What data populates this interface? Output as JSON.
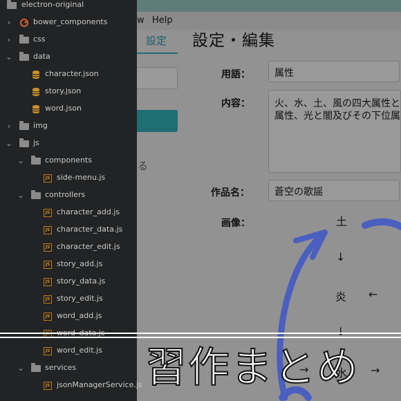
{
  "menu": {
    "view_fragment": "w",
    "help": "Help"
  },
  "tab": {
    "settings": "設定"
  },
  "left_pane": {
    "link_fragment": "る"
  },
  "page": {
    "title": "設定・編集"
  },
  "form": {
    "term_label": "用語：",
    "term_value": "属性",
    "content_label": "内容：",
    "content_line1": "火、水、土、風の四大属性と焔、",
    "content_line2": "属性、光と闇及びその下位属性",
    "work_label": "作品名：",
    "work_value": "蒼空の歌謡",
    "image_label": "画像："
  },
  "diagram": {
    "earth": "土",
    "arrow_down": "↓",
    "flame": "炎",
    "arrow_left": "←",
    "arrow_down2": "↓",
    "arrow_right_bottom": "→",
    "water": "水",
    "arrow_right": "→"
  },
  "file_tree": [
    {
      "label": "electron-original",
      "type": "root"
    },
    {
      "label": "bower_components",
      "type": "bower"
    },
    {
      "label": "css",
      "type": "folder"
    },
    {
      "label": "data",
      "type": "folder-open"
    },
    {
      "label": "character.json",
      "type": "db"
    },
    {
      "label": "story.json",
      "type": "db"
    },
    {
      "label": "word.json",
      "type": "db"
    },
    {
      "label": "img",
      "type": "folder"
    },
    {
      "label": "js",
      "type": "folder-open"
    },
    {
      "label": "components",
      "type": "folder-open"
    },
    {
      "label": "side-menu.js",
      "type": "js"
    },
    {
      "label": "controllers",
      "type": "folder-open"
    },
    {
      "label": "character_add.js",
      "type": "js"
    },
    {
      "label": "character_data.js",
      "type": "js"
    },
    {
      "label": "character_edit.js",
      "type": "js"
    },
    {
      "label": "story_add.js",
      "type": "js"
    },
    {
      "label": "story_data.js",
      "type": "js"
    },
    {
      "label": "story_edit.js",
      "type": "js"
    },
    {
      "label": "word_add.js",
      "type": "js"
    },
    {
      "label": "word_data.js",
      "type": "js"
    },
    {
      "label": "word_edit.js",
      "type": "js"
    },
    {
      "label": "services",
      "type": "folder-open"
    },
    {
      "label": "jsonManagerService.js",
      "type": "js"
    }
  ],
  "caption": {
    "text": "習作まとめ"
  },
  "colors": {
    "sidebar_bg": "#222324",
    "accent_teal": "#1f6e75",
    "arrow_blue": "#4a5fc0",
    "js_orange": "#d18a22"
  }
}
